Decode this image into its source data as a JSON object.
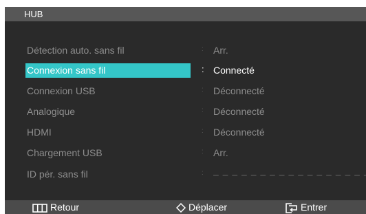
{
  "title": "HUB",
  "menu": [
    {
      "label": "Détection auto. sans fil",
      "separator": ":",
      "value": "Arr."
    },
    {
      "label": "Connexion sans fil",
      "separator": ":",
      "value": "Connecté"
    },
    {
      "label": "Connexion USB",
      "separator": ":",
      "value": "Déconnecté"
    },
    {
      "label": "Analogique",
      "separator": ":",
      "value": "Déconnecté"
    },
    {
      "label": "HDMI",
      "separator": ":",
      "value": "Déconnecté"
    },
    {
      "label": "Chargement USB",
      "separator": ":",
      "value": "Arr."
    },
    {
      "label": "ID pér. sans fil",
      "separator": ":",
      "value": "– – – – – – – – – – – – – – – – –"
    }
  ],
  "selected_index": 1,
  "footer": {
    "back_label": "Retour",
    "move_label": "Déplacer",
    "enter_label": "Entrer",
    "back_icon": "menu-bars-icon",
    "move_icon": "diamond-arrows-icon",
    "enter_icon": "enter-arrow-icon"
  },
  "colors": {
    "background": "#2a2a2a",
    "title_bar": "#575757",
    "highlight": "#34c6c8",
    "footer_bar": "#4b4b4b",
    "inactive_text": "#8d8d8d"
  }
}
